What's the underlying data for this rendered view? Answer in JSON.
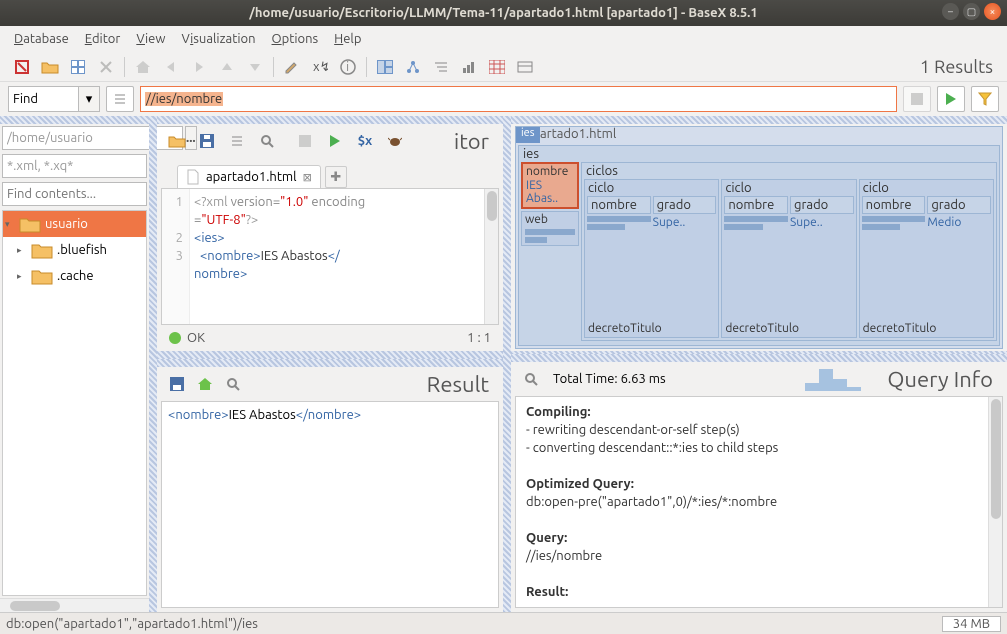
{
  "title": "/home/usuario/Escritorio/LLMM/Tema-11/apartado1.html [apartado1] - BaseX 8.5.1",
  "menu": {
    "db": "Database",
    "ed": "Editor",
    "vw": "View",
    "viz": "Visualization",
    "opt": "Options",
    "hlp": "Help"
  },
  "results_label": "1 Results",
  "find": {
    "label": "Find",
    "xpath": "//ies/nombre"
  },
  "left": {
    "path": "/home/usuario",
    "filter": "*.xml, *.xq*",
    "contents": "Find contents...",
    "tree": [
      {
        "name": "usuario",
        "sel": true,
        "exp": true,
        "depth": 0
      },
      {
        "name": ".bluefish",
        "sel": false,
        "exp": false,
        "depth": 1,
        "cut": true
      },
      {
        "name": ".cache",
        "sel": false,
        "exp": false,
        "depth": 1
      }
    ]
  },
  "editor": {
    "title": "itor",
    "tab": "apartado1.html",
    "lines": [
      "1",
      "2",
      "3"
    ],
    "status_ok": "OK",
    "pos": "1 : 1",
    "code": {
      "l1a": "<?xml ",
      "l1b": "version=",
      "l1c": "\"1.0\"",
      "l1d": " encoding\n=",
      "l1e": "\"UTF-8\"",
      "l1f": "?>",
      "l2": "<ies>",
      "l3a": "  <nombre>",
      "l3b": "IES Abastos",
      "l3c": "</\nnombre>"
    }
  },
  "viz": {
    "root": "ies",
    "doc": "artado1.html",
    "ies": "ies",
    "nombre": "nombre",
    "nombre_v": "IES Abas..",
    "web": "web",
    "ciclos": "ciclos",
    "ciclo": "ciclo",
    "nombre2": "nombre",
    "grado": "grado",
    "g1": "Supe..",
    "g2": "Supe..",
    "g3": "Medio",
    "decreto": "decretoTitulo"
  },
  "result": {
    "title": "Result",
    "open": "<nombre>",
    "text": "IES Abastos",
    "close": "</nombre>"
  },
  "qi": {
    "title": "Query Info",
    "time": "Total Time: 6.63 ms",
    "comp": "Compiling:",
    "c1": "- rewriting descendant-or-self step(s)",
    "c2": "- converting descendant::*:ies to child steps",
    "oq": "Optimized Query:",
    "oqv": "db:open-pre(\"apartado1\",0)/*:ies/*:nombre",
    "q": "Query:",
    "qv": "//ies/nombre",
    "r": "Result:"
  },
  "status": {
    "path": "db:open(\"apartado1\",\"apartado1.html\")/ies",
    "mem": "34 MB"
  }
}
